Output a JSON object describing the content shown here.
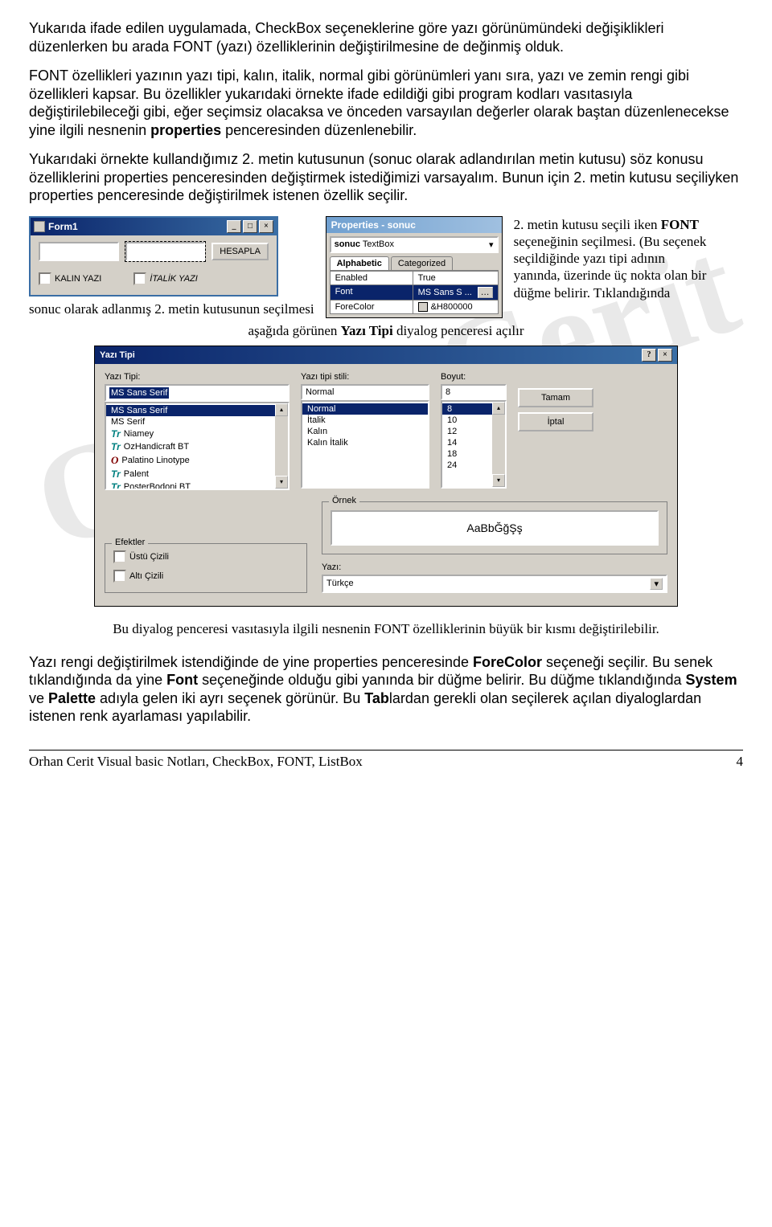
{
  "para1": "Yukarıda ifade edilen uygulamada, CheckBox seçeneklerine göre yazı görünümündeki değişiklikleri düzenlerken bu arada FONT (yazı)  özelliklerinin değiştirilmesine de değinmiş olduk.",
  "para2_a": "FONT özellikleri yazının yazı tipi, kalın, italik, normal gibi görünümleri yanı sıra, yazı ve zemin rengi gibi özellikleri kapsar. Bu özellikler yukarıdaki örnekte ifade edildiği gibi program kodları vasıtasıyla değiştirilebileceği gibi, eğer seçimsiz olacaksa ve önceden varsayılan değerler olarak baştan düzenlenecekse yine ilgili nesnenin ",
  "para2_b": "properties",
  "para2_c": " penceresinden düzenlenebilir.",
  "para3": "Yukarıdaki örnekte kullandığımız 2. metin kutusunun (sonuc olarak adlandırılan metin kutusu) söz konusu özelliklerini properties penceresinden değiştirmek istediğimizi varsayalım. Bunun için 2. metin kutusu seçiliyken properties penceresinde değiştirilmek istenen özellik seçilir.",
  "form1": {
    "title": "Form1",
    "hesapla": "HESAPLA",
    "kalin": "KALIN YAZI",
    "italik": "İTALİK YAZI"
  },
  "caption1": "sonuc olarak adlanmış 2. metin kutusunun seçilmesi",
  "props": {
    "header": "Properties - sonuc",
    "combo_k": "sonuc",
    "combo_v": "TextBox",
    "tab1": "Alphabetic",
    "tab2": "Categorized",
    "rows": [
      {
        "k": "Enabled",
        "v": "True"
      },
      {
        "k": "Font",
        "v": "MS Sans S ..."
      },
      {
        "k": "ForeColor",
        "v": "&H800000"
      }
    ]
  },
  "sidecap_a": "2. metin kutusu seçili iken ",
  "sidecap_b": "FONT",
  "sidecap_c": " seçeneğinin seçilmesi. (Bu seçenek seçildiğinde yazı tipi adının yanında, üzerinde üç nokta olan bir düğme belirir. Tıklandığında",
  "centercap_a": "aşağıda görünen ",
  "centercap_b": "Yazı Tipi",
  "centercap_c": " diyalog penceresi açılır",
  "fontdlg": {
    "title": "Yazı Tipi",
    "lbl_tipi": "Yazı Tipi:",
    "lbl_stil": "Yazı tipi stili:",
    "lbl_boyut": "Boyut:",
    "tipi_val": "MS Sans Serif",
    "stil_val": "Normal",
    "boyut_val": "8",
    "fonts": [
      "MS Sans Serif",
      "MS Serif",
      "Niamey",
      "OzHandicraft BT",
      "Palatino Linotype",
      "Palent",
      "PosterBodoni BT"
    ],
    "styles": [
      "Normal",
      "İtalik",
      "Kalın",
      "Kalın İtalik"
    ],
    "sizes": [
      "8",
      "10",
      "12",
      "14",
      "18",
      "24"
    ],
    "btn_ok": "Tamam",
    "btn_cancel": "İptal",
    "eff_title": "Efektler",
    "eff_strike": "Üstü Çizili",
    "eff_under": "Altı Çizili",
    "sample_title": "Örnek",
    "sample_text": "AaBbĞğŞş",
    "lang_lbl": "Yazı:",
    "lang_val": "Türkçe"
  },
  "after": "Bu diyalog penceresi vasıtasıyla ilgili nesnenin FONT özelliklerinin büyük bir kısmı değiştirilebilir.",
  "para4_a": "Yazı rengi değiştirilmek istendiğinde de yine properties penceresinde ",
  "para4_b": "ForeColor",
  "para4_c": " seçeneği seçilir. Bu senek tıklandığında da yine ",
  "para4_d": "Font",
  "para4_e": " seçeneğinde olduğu gibi yanında bir düğme belirir. Bu düğme tıklandığında ",
  "para4_f": "System",
  "para4_g": " ve ",
  "para4_h": "Palette",
  "para4_i": " adıyla  gelen iki ayrı seçenek görünür. Bu ",
  "para4_j": "Tab",
  "para4_k": "lardan gerekli olan  seçilerek açılan diyaloglardan istenen renk ayarlaması yapılabilir.",
  "footer_l": "Orhan Cerit Visual basic Notları, CheckBox, FONT, ListBox",
  "footer_r": "4"
}
